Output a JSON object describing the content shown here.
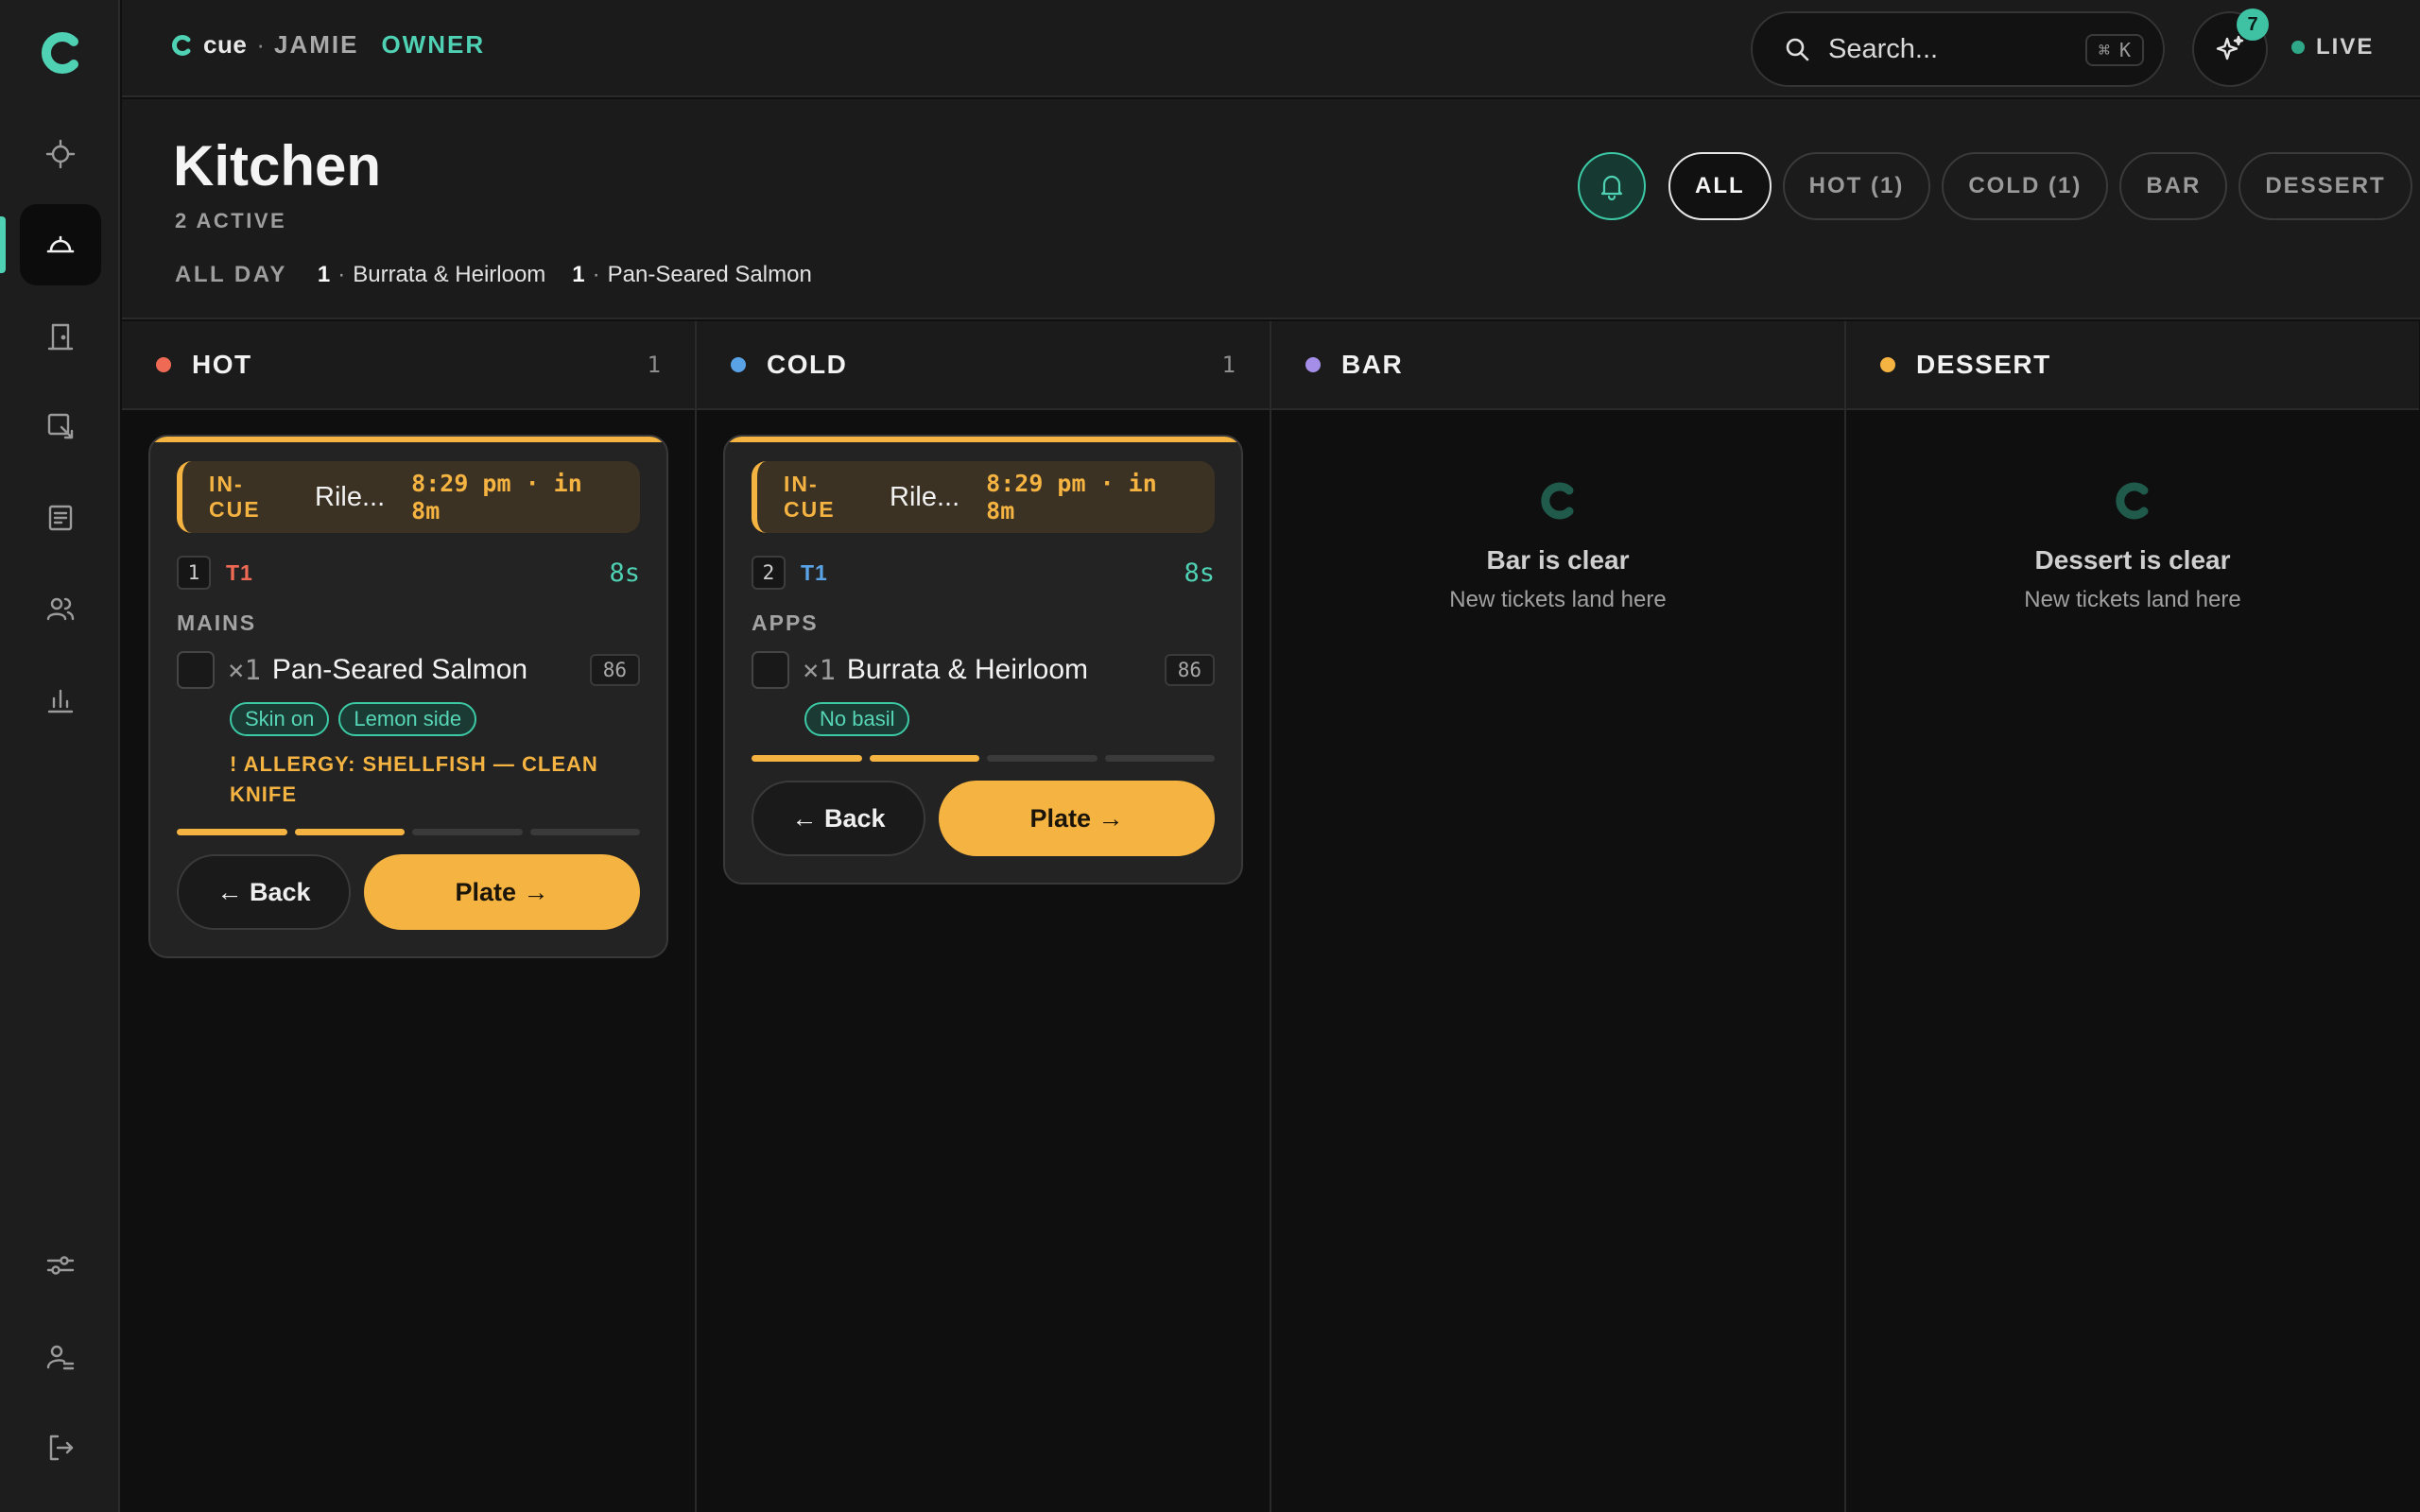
{
  "brand": {
    "name": "cue",
    "separator": "·",
    "user": "JAMIE",
    "role": "OWNER"
  },
  "search": {
    "placeholder": "Search...",
    "shortcut_mod": "⌘",
    "shortcut_key": "K"
  },
  "assistant": {
    "badge": "7"
  },
  "status": {
    "label": "LIVE",
    "color": "#2fa889"
  },
  "sidebar": {
    "items": [
      {
        "icon": "crosshair-icon",
        "active": false
      },
      {
        "icon": "cloche-icon",
        "active": true
      },
      {
        "icon": "door-icon",
        "active": false
      },
      {
        "icon": "floor-plan-icon",
        "active": false
      },
      {
        "icon": "receipt-icon",
        "active": false
      },
      {
        "icon": "users-icon",
        "active": false
      },
      {
        "icon": "bar-chart-icon",
        "active": false
      }
    ],
    "bottom_items": [
      {
        "icon": "sliders-icon"
      },
      {
        "icon": "user-settings-icon"
      },
      {
        "icon": "logout-icon"
      }
    ]
  },
  "header": {
    "title": "Kitchen",
    "active_count": "2 ACTIVE",
    "allday_label": "ALL DAY",
    "allday": [
      {
        "count": "1",
        "sep": "·",
        "name": "Burrata & Heirloom"
      },
      {
        "count": "1",
        "sep": "·",
        "name": "Pan-Seared Salmon"
      }
    ],
    "filters": [
      {
        "label": "ALL",
        "active": true
      },
      {
        "label": "HOT (1)",
        "active": false
      },
      {
        "label": "COLD (1)",
        "active": false
      },
      {
        "label": "BAR",
        "active": false
      },
      {
        "label": "DESSERT",
        "active": false
      }
    ]
  },
  "columns": [
    {
      "name": "HOT",
      "count": "1",
      "color": "#ef6a55"
    },
    {
      "name": "COLD",
      "count": "1",
      "color": "#5aa2e6"
    },
    {
      "name": "BAR",
      "count": "",
      "color": "#a48ee8",
      "empty_title": "Bar is clear",
      "empty_sub": "New tickets land here"
    },
    {
      "name": "DESSERT",
      "count": "",
      "color": "#f5b342",
      "empty_title": "Dessert is clear",
      "empty_sub": "New tickets land here"
    }
  ],
  "tickets": [
    {
      "status": "IN-CUE",
      "guest": "Rile...",
      "time": "8:29 pm · in 8m",
      "seat": "1",
      "table": "T1",
      "table_color": "#ef6a55",
      "timer": "8s",
      "course": "MAINS",
      "qty": "×1",
      "item": "Pan-Seared Salmon",
      "eighty_six": "86",
      "mods": [
        "Skin on",
        "Lemon side"
      ],
      "allergy": "! ALLERGY: SHELLFISH — CLEAN KNIFE",
      "progress": 0.5,
      "back": "← Back",
      "plate": "Plate →"
    },
    {
      "status": "IN-CUE",
      "guest": "Rile...",
      "time": "8:29 pm · in 8m",
      "seat": "2",
      "table": "T1",
      "table_color": "#5aa2e6",
      "timer": "8s",
      "course": "APPS",
      "qty": "×1",
      "item": "Burrata & Heirloom",
      "eighty_six": "86",
      "mods": [
        "No basil"
      ],
      "allergy": "",
      "progress": 0.5,
      "back": "← Back",
      "plate": "Plate →"
    }
  ]
}
